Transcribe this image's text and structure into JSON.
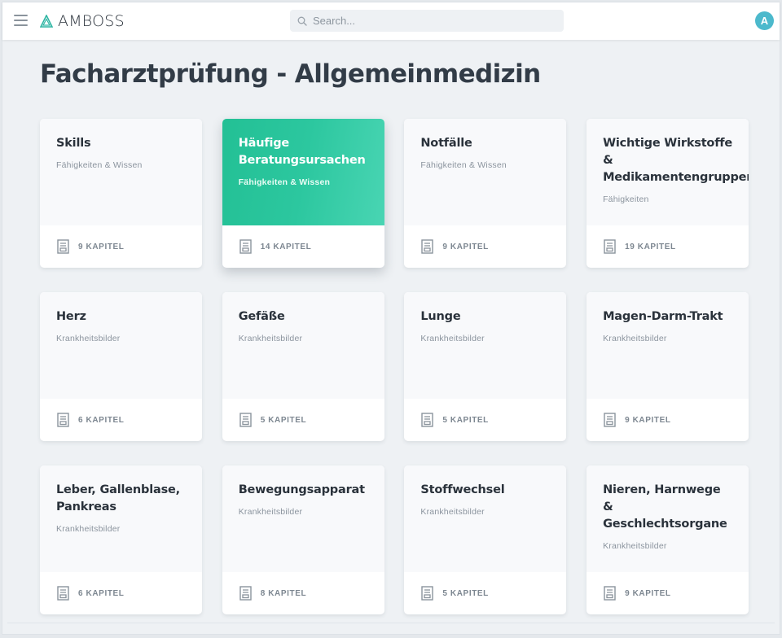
{
  "topbar": {
    "menu_icon": "hamburger-menu-icon",
    "logo_text": "AMBOSS",
    "search_placeholder": "Search...",
    "search_value": "",
    "avatar_initial": "A"
  },
  "page_title": "Facharztprüfung - Allgemeinmedizin",
  "colors": {
    "accent_start": "#23c095",
    "accent_end": "#49d5b3",
    "avatar": "#4cb9cc",
    "logo": "#2fb5a3"
  },
  "cards": [
    {
      "title": "Skills",
      "subtitle": "Fähigkeiten & Wissen",
      "chapters": "9 KAPITEL",
      "active": false
    },
    {
      "title": "Häufige Beratungsursachen",
      "subtitle": "Fähigkeiten & Wissen",
      "chapters": "14 KAPITEL",
      "active": true
    },
    {
      "title": "Notfälle",
      "subtitle": "Fähigkeiten & Wissen",
      "chapters": "9 KAPITEL",
      "active": false
    },
    {
      "title": "Wichtige Wirkstoffe & Medikamentengruppen",
      "subtitle": "Fähigkeiten",
      "chapters": "19 KAPITEL",
      "active": false
    },
    {
      "title": "Herz",
      "subtitle": "Krankheitsbilder",
      "chapters": "6 KAPITEL",
      "active": false
    },
    {
      "title": "Gefäße",
      "subtitle": "Krankheitsbilder",
      "chapters": "5 KAPITEL",
      "active": false
    },
    {
      "title": "Lunge",
      "subtitle": "Krankheitsbilder",
      "chapters": "5 KAPITEL",
      "active": false
    },
    {
      "title": "Magen-Darm-Trakt",
      "subtitle": "Krankheitsbilder",
      "chapters": "9 KAPITEL",
      "active": false
    },
    {
      "title": "Leber, Gallenblase, Pankreas",
      "subtitle": "Krankheitsbilder",
      "chapters": "6 KAPITEL",
      "active": false
    },
    {
      "title": "Bewegungsapparat",
      "subtitle": "Krankheitsbilder",
      "chapters": "8 KAPITEL",
      "active": false
    },
    {
      "title": "Stoffwechsel",
      "subtitle": "Krankheitsbilder",
      "chapters": "5 KAPITEL",
      "active": false
    },
    {
      "title": "Nieren, Harnwege & Geschlechtsorgane",
      "subtitle": "Krankheitsbilder",
      "chapters": "9 KAPITEL",
      "active": false
    }
  ]
}
